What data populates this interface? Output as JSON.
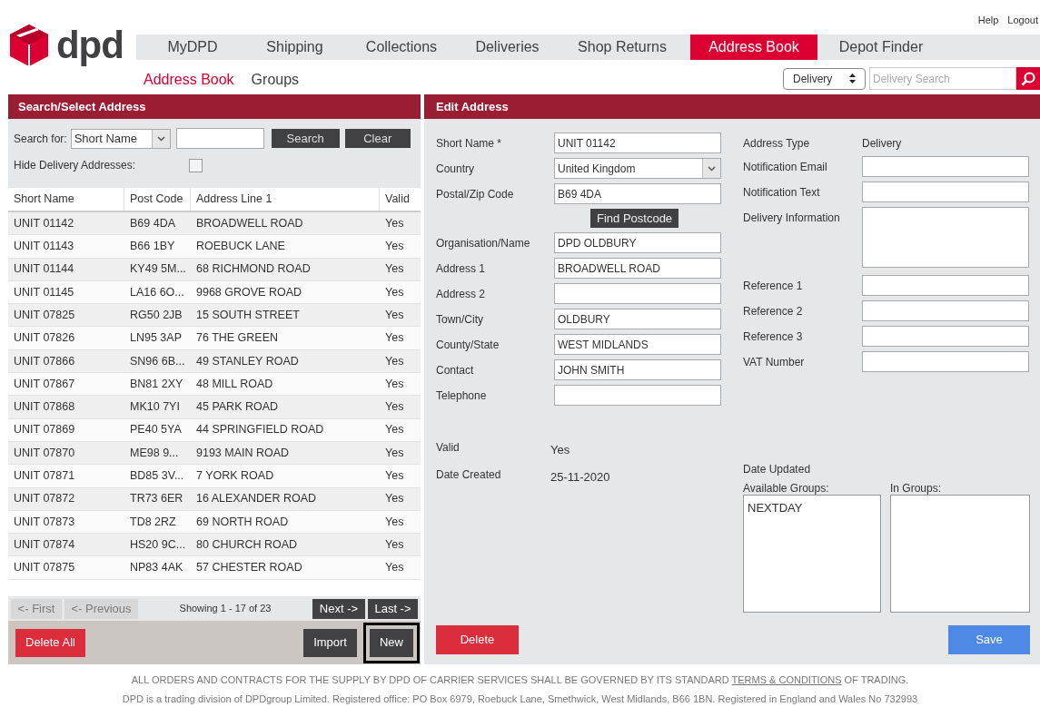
{
  "top_links": [
    "Help",
    "Logout"
  ],
  "logo": {
    "text": "dpd"
  },
  "nav": [
    {
      "label": "MyDPD",
      "selected": false
    },
    {
      "label": "Shipping",
      "selected": false
    },
    {
      "label": "Collections",
      "selected": false
    },
    {
      "label": "Deliveries",
      "selected": false
    },
    {
      "label": "Shop Returns",
      "selected": false
    },
    {
      "label": "Address Book",
      "selected": true
    },
    {
      "label": "Depot Finder",
      "selected": false
    }
  ],
  "subnav": [
    {
      "label": "Address Book",
      "selected": true
    },
    {
      "label": "Groups",
      "selected": false
    }
  ],
  "quick_search": {
    "type": "Delivery",
    "placeholder": "Delivery Search"
  },
  "search_panel": {
    "title": "Search/Select Address",
    "search_for_label": "Search for:",
    "search_for": "Short Name",
    "search_button": "Search",
    "clear_button": "Clear",
    "hide_label": "Hide Delivery Addresses:",
    "hide_checked": false
  },
  "table": {
    "columns": [
      "Short Name",
      "Post Code",
      "Address Line 1",
      "Valid"
    ],
    "rows": [
      [
        "UNIT 01142",
        "B69 4DA",
        "BROADWELL ROAD",
        "Yes"
      ],
      [
        "UNIT 01143",
        "B66 1BY",
        "ROEBUCK LANE",
        "Yes"
      ],
      [
        "UNIT 01144",
        "KY49 5M...",
        "68 RICHMOND ROAD",
        "Yes"
      ],
      [
        "UNIT 01145",
        "LA16 6O...",
        "9968 GROVE ROAD",
        "Yes"
      ],
      [
        "UNIT 07825",
        "RG50 2JB",
        "15 SOUTH STREET",
        "Yes"
      ],
      [
        "UNIT 07826",
        "LN95 3AP",
        "76 THE GREEN",
        "Yes"
      ],
      [
        "UNIT 07866",
        "SN96 6B...",
        "49 STANLEY ROAD",
        "Yes"
      ],
      [
        "UNIT 07867",
        "BN81 2XY",
        "48 MILL ROAD",
        "Yes"
      ],
      [
        "UNIT 07868",
        "MK10 7YI",
        "45 PARK ROAD",
        "Yes"
      ],
      [
        "UNIT 07869",
        "PE40 5YA",
        "44 SPRINGFIELD ROAD",
        "Yes"
      ],
      [
        "UNIT 07870",
        "ME98 9...",
        "9193 MAIN ROAD",
        "Yes"
      ],
      [
        "UNIT 07871",
        "BD85 3V...",
        "7 YORK ROAD",
        "Yes"
      ],
      [
        "UNIT 07872",
        "TR73 6ER",
        "16 ALEXANDER ROAD",
        "Yes"
      ],
      [
        "UNIT 07873",
        "TD8 2RZ",
        "69 NORTH ROAD",
        "Yes"
      ],
      [
        "UNIT 07874",
        "HS20 9C...",
        "80 CHURCH ROAD",
        "Yes"
      ],
      [
        "UNIT 07875",
        "NP83 4AK",
        "57 CHESTER ROAD",
        "Yes"
      ]
    ]
  },
  "pager": {
    "buttons": [
      {
        "label": "<- First",
        "disabled": true
      },
      {
        "label": "<- Previous",
        "disabled": true
      },
      {
        "label": "Next ->",
        "disabled": false
      },
      {
        "label": "Last ->",
        "disabled": false
      }
    ],
    "status": "Showing 1 - 17 of 23"
  },
  "left_actions": [
    {
      "label": "Delete All",
      "kind": "danger",
      "highlighted": false
    },
    {
      "label": "Import",
      "kind": "dark",
      "highlighted": false
    },
    {
      "label": "New",
      "kind": "dark",
      "highlighted": true
    }
  ],
  "edit_panel": {
    "title": "Edit Address",
    "left_fields": [
      {
        "label": "Short Name *",
        "kind": "input",
        "value": "UNIT 01142"
      },
      {
        "label": "Country",
        "kind": "select",
        "value": "United Kingdom"
      },
      {
        "label": "Postal/Zip Code",
        "kind": "input",
        "value": "B69 4DA"
      },
      {
        "label": "Find Postcode",
        "kind": "button"
      },
      {
        "label": "Organisation/Name",
        "kind": "input",
        "value": "DPD OLDBURY"
      },
      {
        "label": "Address 1",
        "kind": "input",
        "value": "BROADWELL ROAD"
      },
      {
        "label": "Address 2",
        "kind": "input"
      },
      {
        "label": "Town/City",
        "kind": "input",
        "value": "OLDBURY"
      },
      {
        "label": "County/State",
        "kind": "input",
        "value": "WEST MIDLANDS"
      },
      {
        "label": "Contact",
        "kind": "input",
        "value": "JOHN SMITH"
      },
      {
        "label": "Telephone",
        "kind": "input"
      }
    ],
    "right_fields": [
      {
        "label": "Address Type",
        "kind": "text",
        "value": "Delivery"
      },
      {
        "label": "Notification Email",
        "kind": "input"
      },
      {
        "label": "Notification Text",
        "kind": "input"
      },
      {
        "label": "Delivery Information",
        "kind": "textarea"
      },
      {
        "label": "Reference 1",
        "kind": "input"
      },
      {
        "label": "Reference 2",
        "kind": "input"
      },
      {
        "label": "Reference 3",
        "kind": "input"
      },
      {
        "label": "VAT Number",
        "kind": "input"
      }
    ],
    "valid_label": "Valid",
    "valid": "Yes",
    "created_label": "Date Created",
    "created": "25-11-2020",
    "updated_label": "Date Updated",
    "available_groups_label": "Available Groups:",
    "available_groups": [
      "NEXTDAY"
    ],
    "in_groups_label": "In Groups:",
    "delete_button": "Delete",
    "save_button": "Save"
  },
  "footer": {
    "line1_before": "ALL ORDERS AND CONTRACTS FOR THE SUPPLY BY DPD OF CARRIER SERVICES SHALL BE GOVERNED BY ITS STANDARD",
    "line1_link": "TERMS & CONDITIONS",
    "line1_after": "OF TRADING.",
    "line2": "DPD is a trading division of DPDgroup Limited. Registered office: PO Box 6979, Roebuck Lane, Smethwick, West Midlands, B66 1BN. Registered in England and Wales No 732993"
  }
}
